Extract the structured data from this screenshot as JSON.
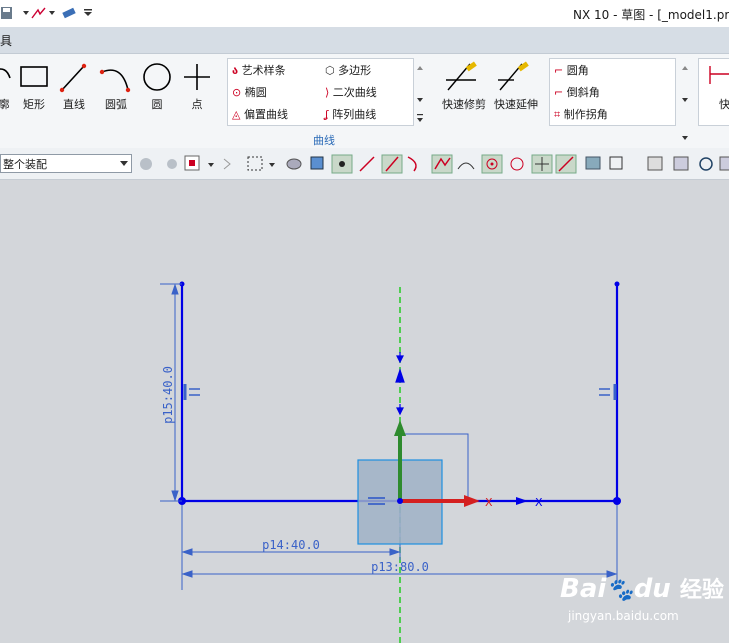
{
  "titlebar": {
    "title": "NX 10 - 草图 - [_model1.pr"
  },
  "menubar": {
    "label": "具"
  },
  "ribbon": {
    "tools_left": [
      {
        "label": "廓",
        "icon": "profile-icon"
      },
      {
        "label": "矩形",
        "icon": "rectangle-icon"
      },
      {
        "label": "直线",
        "icon": "line-icon"
      },
      {
        "label": "圆弧",
        "icon": "arc-icon"
      },
      {
        "label": "圆",
        "icon": "circle-icon"
      },
      {
        "label": "点",
        "icon": "point-icon"
      }
    ],
    "curve_group": {
      "title": "曲线",
      "col1": [
        "艺术样条",
        "椭圆",
        "偏置曲线"
      ],
      "col2": [
        "多边形",
        "二次曲线",
        "阵列曲线"
      ]
    },
    "quick_trim": "快速修剪",
    "quick_extend": "快速延伸",
    "corner_group": [
      "圆角",
      "倒斜角",
      "制作拐角"
    ],
    "right_tool": "快速"
  },
  "toolbar2": {
    "assembly_combo": "整个装配"
  },
  "sketch": {
    "dim_p15": "p15:40.0",
    "dim_p14": "p14:40.0",
    "dim_p13": "p13:80.0",
    "axis_label": "X"
  },
  "watermark": {
    "brand": "Bai",
    "brand2": "du",
    "cn": "经验",
    "url": "jingyan.baidu.com"
  },
  "colors": {
    "sketch_blue": "#0000e6",
    "dim_blue": "#3a62c8",
    "centerline_green": "#22cc22",
    "axis_green": "#2e8b2e",
    "axis_red": "#d42020"
  }
}
